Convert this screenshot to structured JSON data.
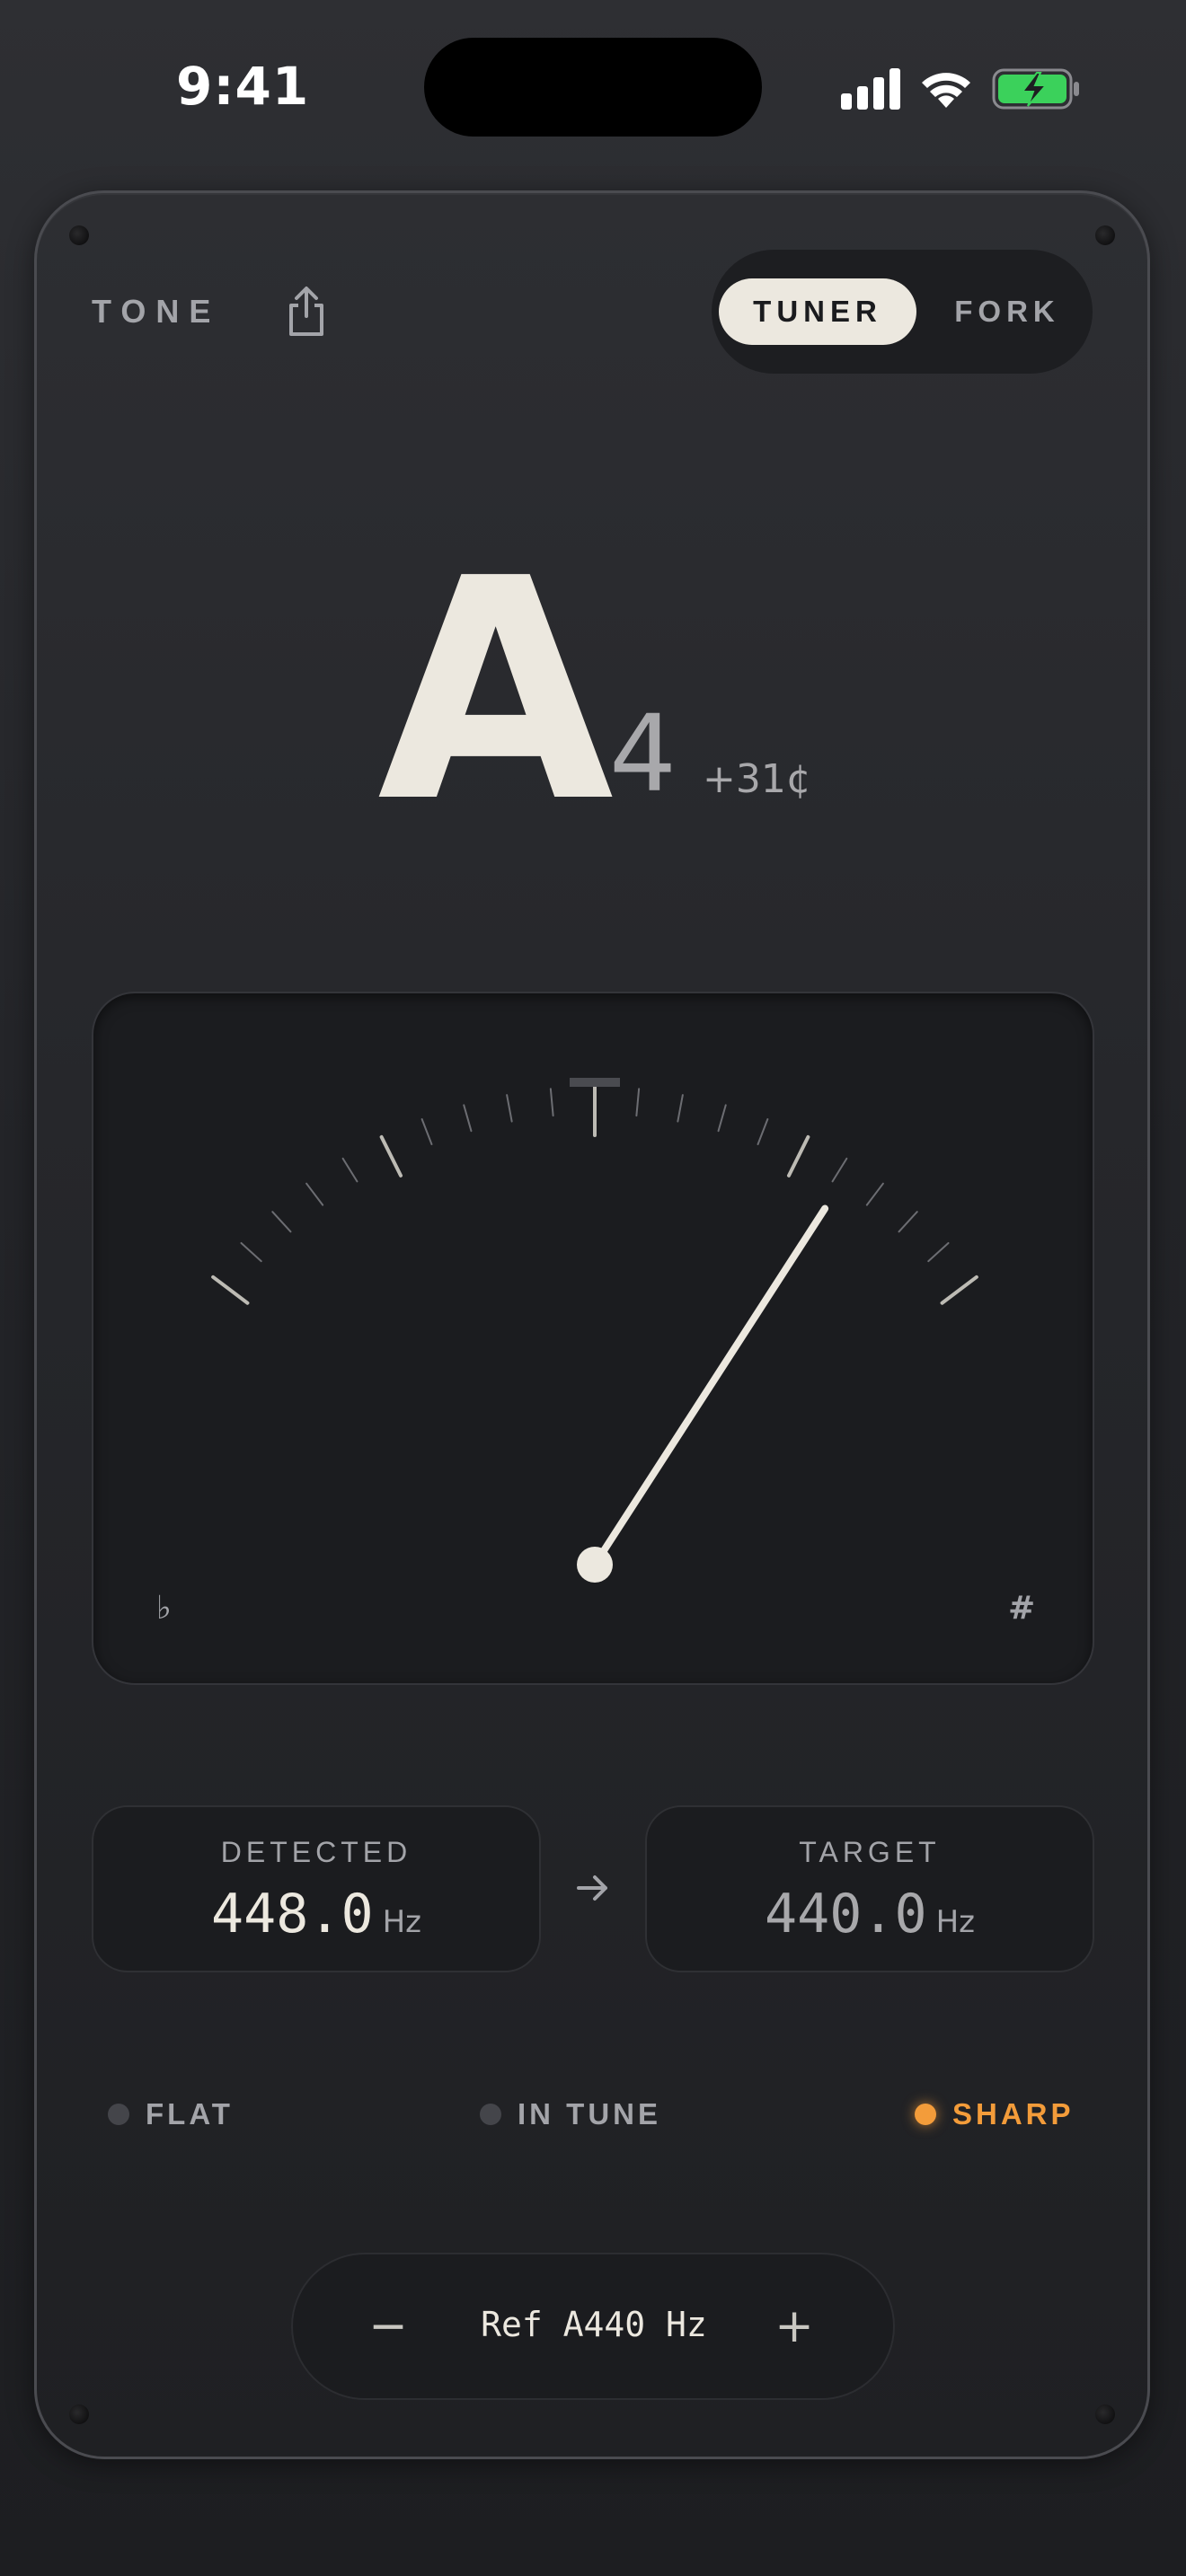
{
  "status_bar": {
    "time": "9:41"
  },
  "header": {
    "brand": "TONE",
    "modes": [
      {
        "label": "TUNER",
        "active": true
      },
      {
        "label": "FORK",
        "active": false
      }
    ]
  },
  "note": {
    "letter": "A",
    "octave": "4",
    "cents": "+31¢"
  },
  "meter": {
    "flat_symbol": "♭",
    "sharp_symbol": "#",
    "cents_range": [
      -50,
      50
    ],
    "needle_cents": 31
  },
  "detected": {
    "label": "DETECTED",
    "value": "448.0",
    "unit": "Hz"
  },
  "target": {
    "label": "TARGET",
    "value": "440.0",
    "unit": "Hz"
  },
  "indicators": [
    {
      "label": "FLAT",
      "active": false
    },
    {
      "label": "IN TUNE",
      "active": false
    },
    {
      "label": "SHARP",
      "active": true
    }
  ],
  "reference": {
    "label": "Ref A440 Hz",
    "minus": "−",
    "plus": "+"
  },
  "colors": {
    "accent": "#f39c3a",
    "ivory": "#ece8df",
    "panel": "#1b1c1f"
  }
}
